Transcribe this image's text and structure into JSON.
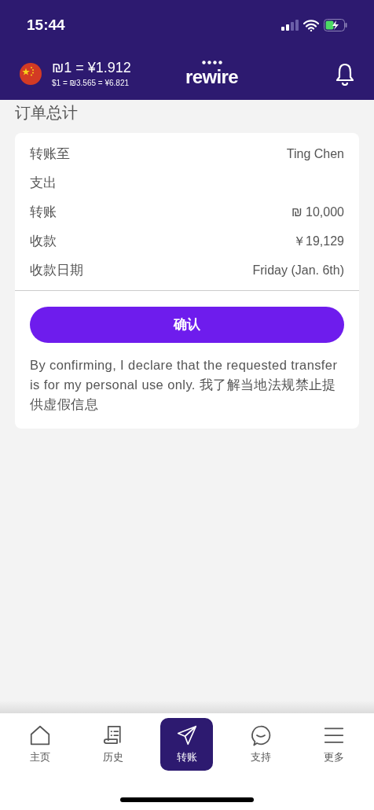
{
  "status_bar": {
    "time": "15:44"
  },
  "header": {
    "rate": "₪1 = ¥1.912",
    "subrate": "$1 = ₪3.565 = ¥6.821",
    "logo": "rewire"
  },
  "section_title": "订单总计",
  "summary": {
    "rows": [
      {
        "label": "转账至",
        "value": "Ting Chen"
      },
      {
        "label": "支出"
      },
      {
        "label": "转账",
        "value": "₪ 10,000"
      },
      {
        "label": "收款",
        "value": "￥19,129"
      },
      {
        "label": "收款日期",
        "value": "Friday (Jan. 6th)"
      }
    ],
    "confirm_button": "确认",
    "disclaimer": "By confirming, I declare that the requested transfer is for my personal use only. 我了解当地法规禁止提供虚假信息"
  },
  "tab_bar": [
    {
      "label": "主页",
      "kind": "home",
      "selected": false
    },
    {
      "label": "历史",
      "kind": "history",
      "selected": false
    },
    {
      "label": "转账",
      "kind": "send",
      "selected": true
    },
    {
      "label": "支持",
      "kind": "support",
      "selected": false
    },
    {
      "label": "更多",
      "kind": "menu",
      "selected": false
    }
  ]
}
